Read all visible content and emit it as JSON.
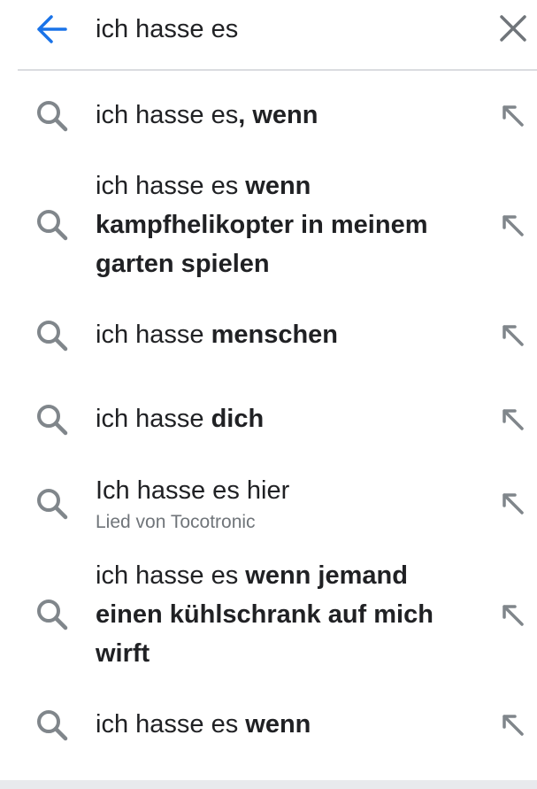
{
  "search": {
    "query": "ich hasse es"
  },
  "icons": {
    "back": "arrow-left-icon",
    "clear": "close-icon",
    "suggestion": "search-icon",
    "fill": "arrow-up-left-icon"
  },
  "colors": {
    "accent": "#1a73e8",
    "icon_gray": "#80868b",
    "text": "#202124",
    "subtext": "#70757a"
  },
  "suggestions": [
    {
      "parts": [
        "ich hasse es",
        ", wenn"
      ]
    },
    {
      "parts": [
        "ich hasse es",
        " wenn",
        "kampfhelikopter in meinem",
        "garten spielen"
      ]
    },
    {
      "parts": [
        "ich hasse",
        " menschen"
      ]
    },
    {
      "parts": [
        "ich hasse",
        " dich"
      ]
    },
    {
      "parts": [
        "Ich hasse es hier"
      ],
      "subtitle": "Lied von Tocotronic"
    },
    {
      "parts": [
        "ich hasse es",
        " wenn jemand",
        "einen kühlschrank auf mich",
        "wirft"
      ]
    },
    {
      "parts": [
        "ich hasse es",
        " wenn"
      ]
    }
  ]
}
